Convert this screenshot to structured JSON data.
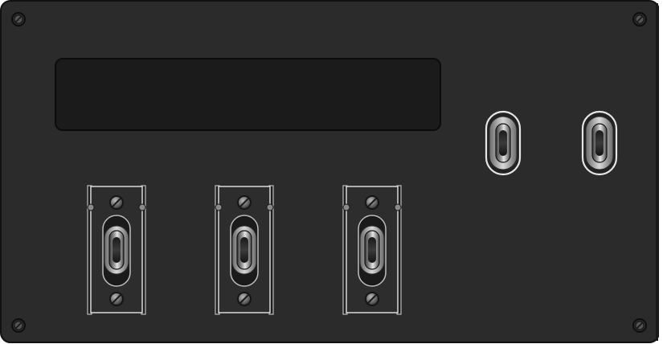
{
  "panel": {
    "display_window": {
      "text": ""
    },
    "guarded_switches": [
      {
        "id": "switch-1",
        "state": "center"
      },
      {
        "id": "switch-2",
        "state": "center"
      },
      {
        "id": "switch-3",
        "state": "center"
      }
    ],
    "toggle_switches": [
      {
        "id": "toggle-1",
        "state": "center"
      },
      {
        "id": "toggle-2",
        "state": "center"
      }
    ]
  },
  "colors": {
    "panel_face": "#2b2b2b",
    "panel_edge": "#111111",
    "display_bg": "#1b1b1b",
    "bracket": "#2d2d2d",
    "bracket_edge": "#d9d9d9",
    "screw_fill": "#7a7a7a",
    "toggle_ring": "#cfcfcf"
  }
}
